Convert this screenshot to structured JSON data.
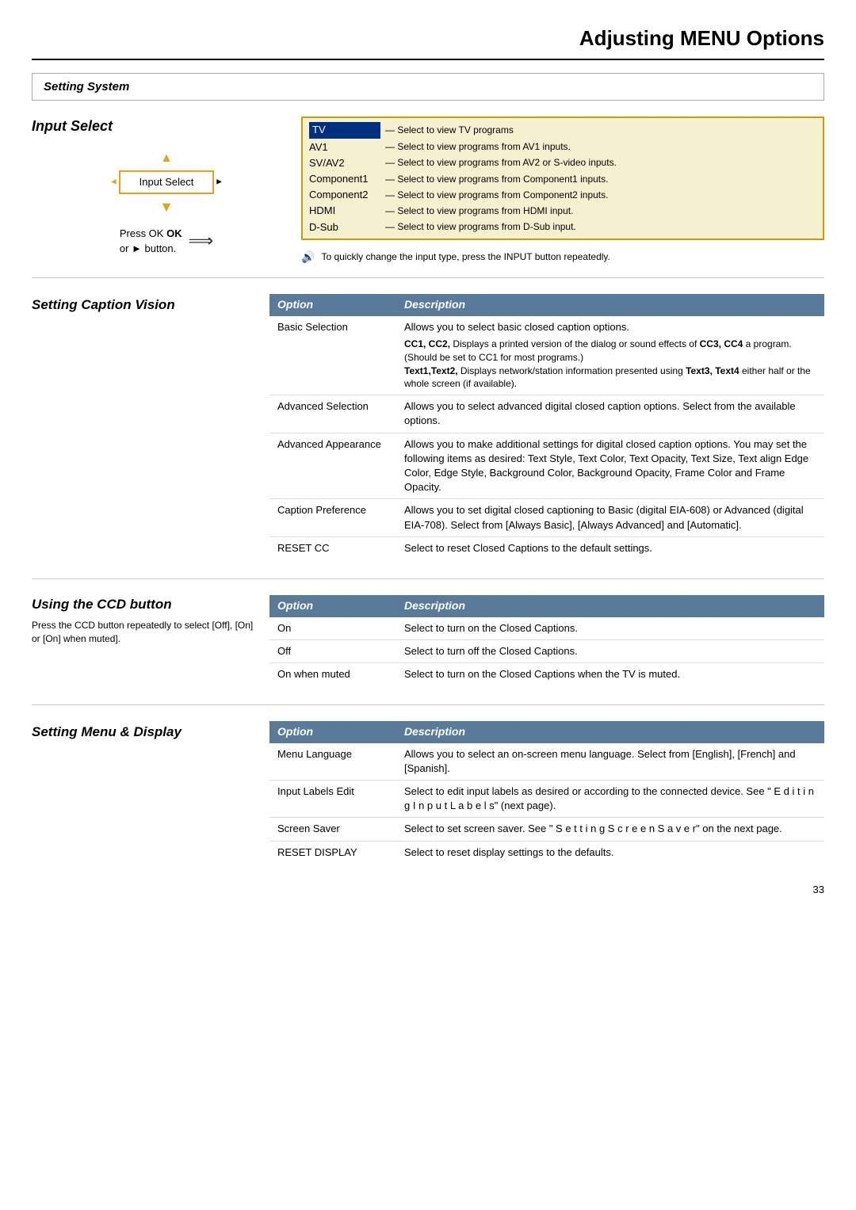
{
  "page": {
    "title": "Adjusting MENU Options",
    "page_number": "33"
  },
  "setting_system": {
    "label": "Setting System"
  },
  "input_select": {
    "title": "Input Select",
    "menu_label": "Input Select",
    "press_ok_text": "Press OK",
    "or_button_text": "or ► button.",
    "channels": [
      {
        "name": "TV",
        "desc": "Select to view TV programs",
        "highlighted": true
      },
      {
        "name": "AV1",
        "desc": "Select to view programs from AV1 inputs."
      },
      {
        "name": "SV/AV2",
        "desc": "Select to view programs from AV2 or S-video inputs."
      },
      {
        "name": "Component1",
        "desc": "Select to view programs from Component1 inputs."
      },
      {
        "name": "Component2",
        "desc": "Select to view programs from Component2 inputs."
      },
      {
        "name": "HDMI",
        "desc": "Select to view programs from HDMI input."
      },
      {
        "name": "D-Sub",
        "desc": "Select to view programs from D-Sub input."
      }
    ],
    "note": "To quickly change the input type, press the INPUT button repeatedly."
  },
  "caption_vision": {
    "title": "Setting Caption Vision",
    "table_headers": {
      "option": "Option",
      "description": "Description"
    },
    "rows": [
      {
        "option": "Basic Selection",
        "description": "Allows you to select basic closed caption options.",
        "sub": "CC1, CC2, Displays a printed version of the dialog or sound effects of CC3, CC4 a program. (Should be set to CC1 for most programs.) Text1,Text2, Displays network/station information presented using Text3, Text4 either half or the whole screen (if available)."
      },
      {
        "option": "Advanced Selection",
        "description": "Allows you to select advanced digital closed caption options. Select from the available options."
      },
      {
        "option": "Advanced Appearance",
        "description": "Allows you to make additional settings for digital closed caption options. You may set the following items as desired: Text Style, Text Color, Text Opacity, Text Size, Text align Edge Color, Edge Style, Background Color, Background Opacity, Frame Color and Frame Opacity."
      },
      {
        "option": "Caption Preference",
        "description": "Allows you to set digital closed captioning to Basic (digital EIA-608) or Advanced (digital EIA-708). Select from [Always Basic], [Always Advanced] and [Automatic]."
      },
      {
        "option": "RESET CC",
        "description": "Select to reset Closed Captions to the default settings."
      }
    ]
  },
  "ccd_button": {
    "title": "Using the CCD button",
    "desc": "Press the CCD button repeatedly to select [Off], [On] or [On] when muted].",
    "table_headers": {
      "option": "Option",
      "description": "Description"
    },
    "rows": [
      {
        "option": "On",
        "description": "Select to turn on the Closed Captions."
      },
      {
        "option": "Off",
        "description": "Select to turn off the Closed Captions."
      },
      {
        "option": "On when muted",
        "description": "Select to turn on the Closed Captions when the TV is muted."
      }
    ]
  },
  "menu_display": {
    "title": "Setting Menu & Display",
    "table_headers": {
      "option": "Option",
      "description": "Description"
    },
    "rows": [
      {
        "option": "Menu Language",
        "description": "Allows you to select an on-screen menu language. Select from [English], [French] and [Spanish]."
      },
      {
        "option": "Input Labels Edit",
        "description": "Select to edit input labels as desired or according to the connected device. See \" E d i t i n g  I n p u t  L a b e l s\" (next page)."
      },
      {
        "option": "Screen Saver",
        "description": "Select to set screen saver. See \" S e t t i n g  S c r e e n  S a v e r\" on the next page."
      },
      {
        "option": "RESET DISPLAY",
        "description": "Select to reset display settings to the defaults."
      }
    ]
  }
}
